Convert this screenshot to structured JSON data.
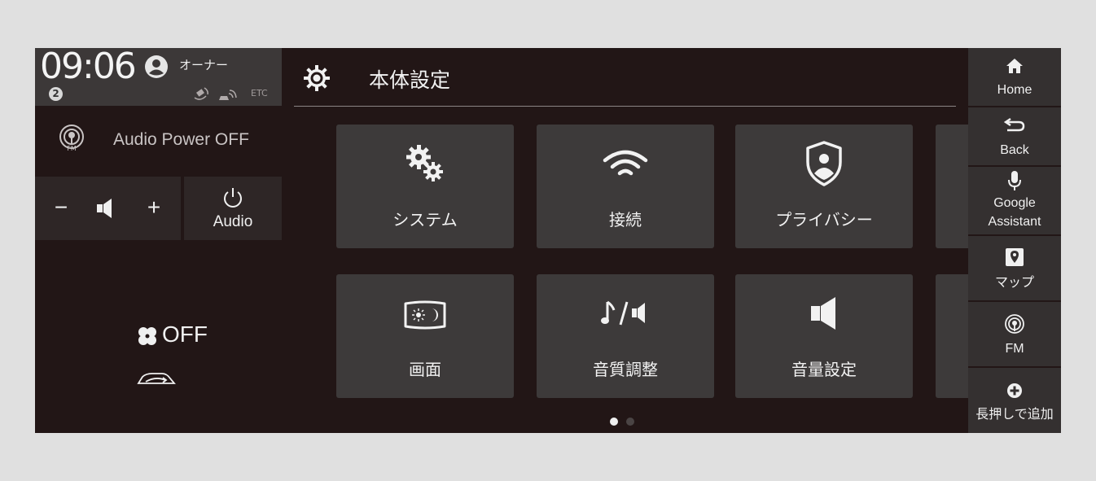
{
  "status": {
    "time": "09:06",
    "user_label": "オーナー",
    "notification_count": "2",
    "etc_label": "ETC"
  },
  "audio": {
    "source_status": "Audio Power OFF",
    "volume_down": "−",
    "volume_up": "+",
    "power_label": "Audio"
  },
  "climate": {
    "fan_status": "OFF"
  },
  "header": {
    "title": "本体設定"
  },
  "tiles": [
    {
      "label": "システム",
      "icon": "gears-icon"
    },
    {
      "label": "接続",
      "icon": "wifi-icon"
    },
    {
      "label": "プライバシー",
      "icon": "privacy-shield-icon"
    },
    {
      "label": "画面",
      "icon": "display-brightness-icon"
    },
    {
      "label": "音質調整",
      "icon": "sound-quality-icon"
    },
    {
      "label": "音量設定",
      "icon": "volume-icon"
    }
  ],
  "pagination": {
    "current": 1,
    "total": 2
  },
  "dock": [
    {
      "label": "Home",
      "icon": "home-icon"
    },
    {
      "label": "Back",
      "icon": "back-icon"
    },
    {
      "label_line1": "Google",
      "label_line2": "Assistant",
      "icon": "microphone-icon"
    },
    {
      "label": "マップ",
      "icon": "map-icon"
    },
    {
      "label": "FM",
      "icon": "fm-icon"
    },
    {
      "label": "長押しで追加",
      "icon": "add-icon"
    }
  ],
  "colors": {
    "background": "#221616",
    "tile": "#3d3a3a",
    "accent_text": "#f2f2f2",
    "dot_active": "#f0f0f0",
    "dot_inactive": "#4a4444"
  }
}
